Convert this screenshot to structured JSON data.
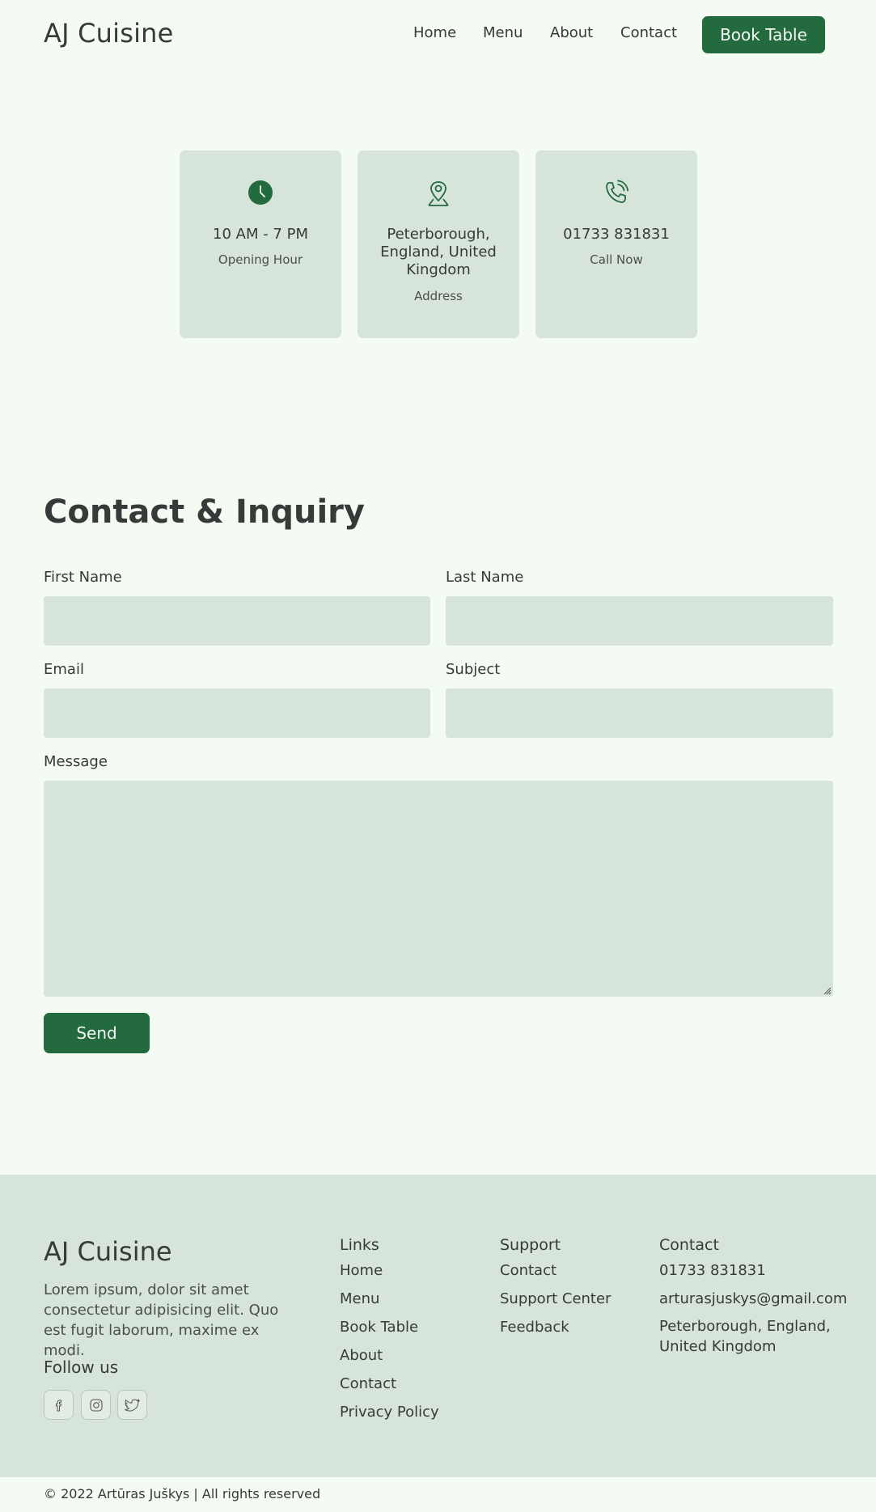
{
  "header": {
    "brand": "AJ Cuisine",
    "nav": [
      "Home",
      "Menu",
      "About",
      "Contact"
    ],
    "book_label": "Book Table"
  },
  "info_cards": [
    {
      "icon": "clock-icon",
      "title": "10 AM - 7 PM",
      "subtitle": "Opening Hour"
    },
    {
      "icon": "map-pin-icon",
      "title": "Peterborough, England, United Kingdom",
      "subtitle": "Address"
    },
    {
      "icon": "phone-icon",
      "title": "01733 831831",
      "subtitle": "Call Now"
    }
  ],
  "contact": {
    "title": "Contact & Inquiry",
    "first_name_label": "First Name",
    "last_name_label": "Last Name",
    "email_label": "Email",
    "subject_label": "Subject",
    "message_label": "Message",
    "send_label": "Send"
  },
  "footer": {
    "brand": "AJ Cuisine",
    "description": "Lorem ipsum, dolor sit amet consectetur adipisicing elit. Quo est fugit laborum, maxime ex modi.",
    "follow_label": "Follow us",
    "social": [
      "facebook-icon",
      "instagram-icon",
      "twitter-icon"
    ],
    "links_title": "Links",
    "links": [
      "Home",
      "Menu",
      "Book Table",
      "About",
      "Contact",
      "Privacy Policy"
    ],
    "support_title": "Support",
    "support": [
      "Contact",
      "Support Center",
      "Feedback"
    ],
    "contact_title": "Contact",
    "phone": "01733 831831",
    "email": "arturasjuskys@gmail.com",
    "address": "Peterborough, England, United Kingdom"
  },
  "copyright": "© 2022 Artūras Juškys | All rights reserved",
  "colors": {
    "background": "#f3fbf2",
    "surface": "#d7e4d9",
    "accent": "#236a3e",
    "text": "#363a38"
  }
}
